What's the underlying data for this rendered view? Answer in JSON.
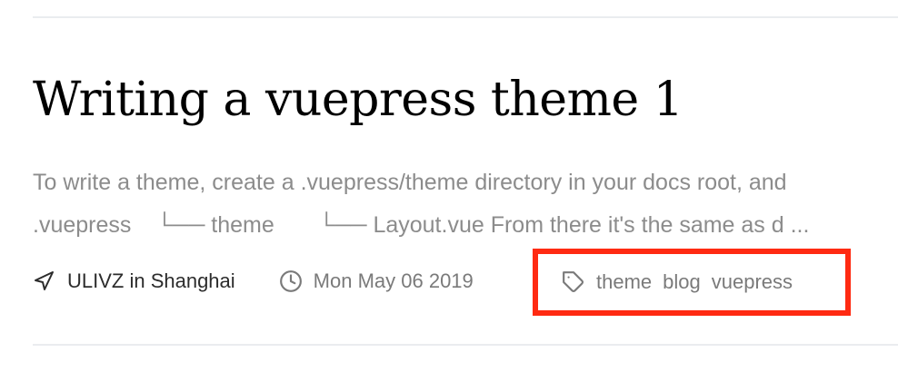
{
  "post": {
    "title": "Writing a vuepress theme 1",
    "excerpt_lines": [
      "To write a theme, create a .vuepress/theme directory in your docs root, and",
      ".vuepress    └── theme       └── Layout.vue From there it's the same as d ..."
    ]
  },
  "meta": {
    "author": "ULIVZ in Shanghai",
    "date": "Mon May 06 2019",
    "tags": [
      "theme",
      "blog",
      "vuepress"
    ]
  },
  "icons": {
    "location": "navigation-arrow-icon",
    "date": "clock-icon",
    "tags": "tag-icon"
  },
  "colors": {
    "title": "#000000",
    "excerpt": "#8c8c8c",
    "meta": "#7a7a7a",
    "author": "#2c2c2c",
    "highlight_box": "#ff2a12",
    "divider": "#eaecef"
  }
}
